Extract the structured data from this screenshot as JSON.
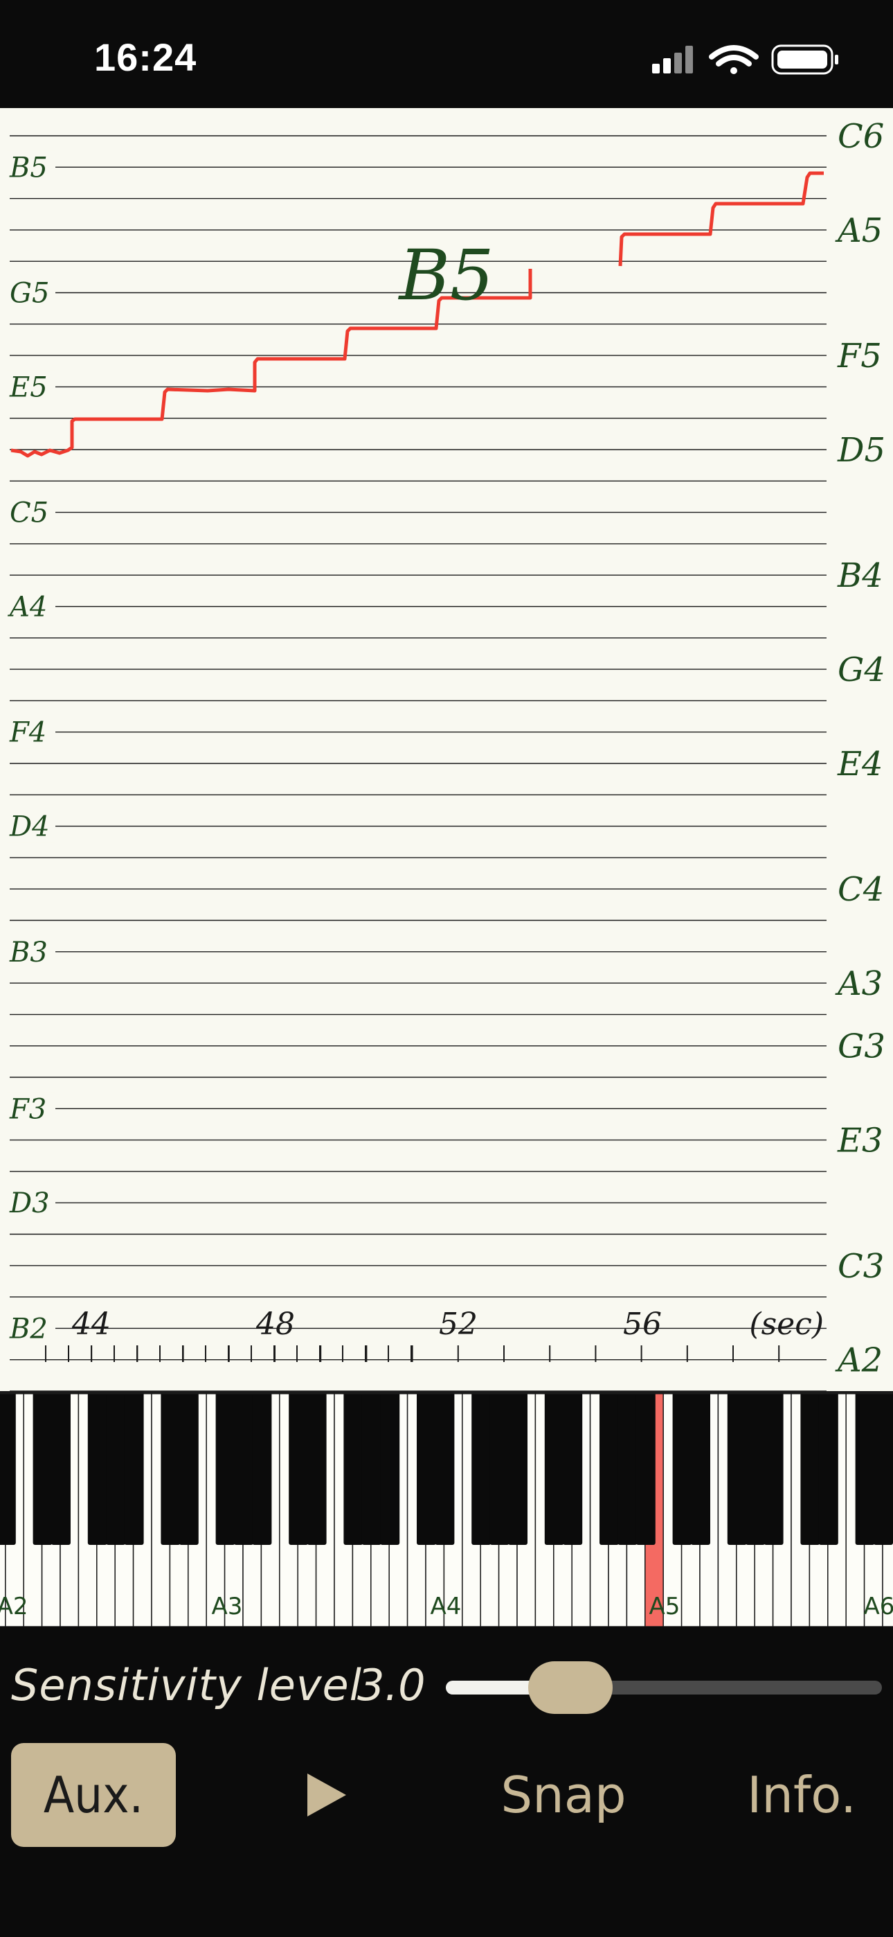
{
  "status_bar": {
    "time": "16:24"
  },
  "pitch_graph": {
    "current_note": "B5",
    "left_labels": [
      "B5",
      "G5",
      "E5",
      "C5",
      "A4",
      "F4",
      "D4",
      "B3",
      "F3",
      "D3",
      "B2"
    ],
    "right_labels": [
      "C6",
      "A5",
      "F5",
      "D5",
      "B4",
      "G4",
      "E4",
      "C4",
      "A3",
      "G3",
      "E3",
      "C3",
      "A2"
    ],
    "time_ticks": [
      "44",
      "48",
      "52",
      "56"
    ],
    "time_unit": "(sec)",
    "line_color": "#ee3b2f",
    "note_label_color": "#1f4a1f"
  },
  "keyboard": {
    "octave_labels": [
      "A2",
      "A3",
      "A4",
      "A5",
      "A6"
    ],
    "highlight_color": "#f46a62"
  },
  "controls": {
    "sensitivity_label": "Sensitivity level",
    "sensitivity_value": "3.0",
    "sensitivity_fraction": 0.19,
    "aux_label": "Aux.",
    "snap_label": "Snap",
    "info_label": "Info.",
    "accent_color": "#c8b896"
  }
}
